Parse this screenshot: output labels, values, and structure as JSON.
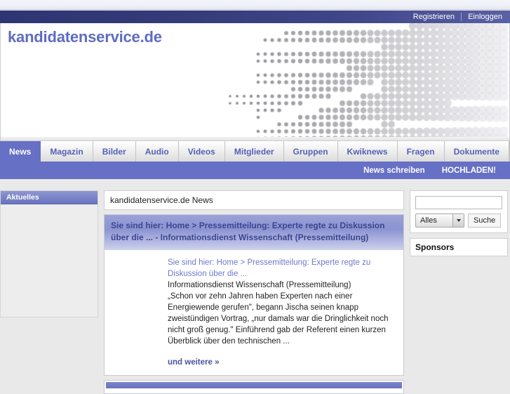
{
  "account_bar": {
    "register_label": "Registrieren",
    "login_label": "Einloggen"
  },
  "header": {
    "logo": "kandidatenservice.de",
    "logo_color": "#5f6cc0"
  },
  "nav": {
    "items": [
      {
        "label": "News",
        "active": true
      },
      {
        "label": "Magazin",
        "active": false
      },
      {
        "label": "Bilder",
        "active": false
      },
      {
        "label": "Audio",
        "active": false
      },
      {
        "label": "Videos",
        "active": false
      },
      {
        "label": "Mitglieder",
        "active": false
      },
      {
        "label": "Gruppen",
        "active": false
      },
      {
        "label": "Kwiknews",
        "active": false
      },
      {
        "label": "Fragen",
        "active": false
      },
      {
        "label": "Dokumente",
        "active": false
      }
    ],
    "rss_icon": "rss-icon",
    "active_color": "#6670c4",
    "link_color": "#5560b5"
  },
  "subnav": {
    "write_news_label": "News schreiben",
    "upload_label": "HOCHLADEN!"
  },
  "sidebar_left": {
    "panel_title": "Aktuelles"
  },
  "main": {
    "page_title": "kandidatenservice.de News",
    "article": {
      "headline": "Sie sind hier: Home > Pressemitteilung: Experte regte zu Diskussion über die ... - Informationsdienst Wissenschaft (Pressemitteilung)",
      "link_text": "Sie sind hier: Home > Pressemitteilung: Experte regte zu Diskussion über die ...",
      "source": "Informationsdienst Wissenschaft (Pressemitteilung)",
      "excerpt": "„Schon vor zehn Jahren haben Experten nach einer Energiewende gerufen\", begann Jischa seinen knapp zweistündigen Vortrag, „nur damals war die Dringlichkeit noch nicht groß genug.\" Einführend gab der Referent einen kurzen Überblick über den technischen ...",
      "more_label": "und weitere »"
    }
  },
  "sidebar_right": {
    "search": {
      "input_value": "",
      "input_placeholder": "",
      "scope_selected": "Alles",
      "scope_options": [
        "Alles"
      ],
      "button_label": "Suche"
    },
    "sponsors_title": "Sponsors"
  }
}
